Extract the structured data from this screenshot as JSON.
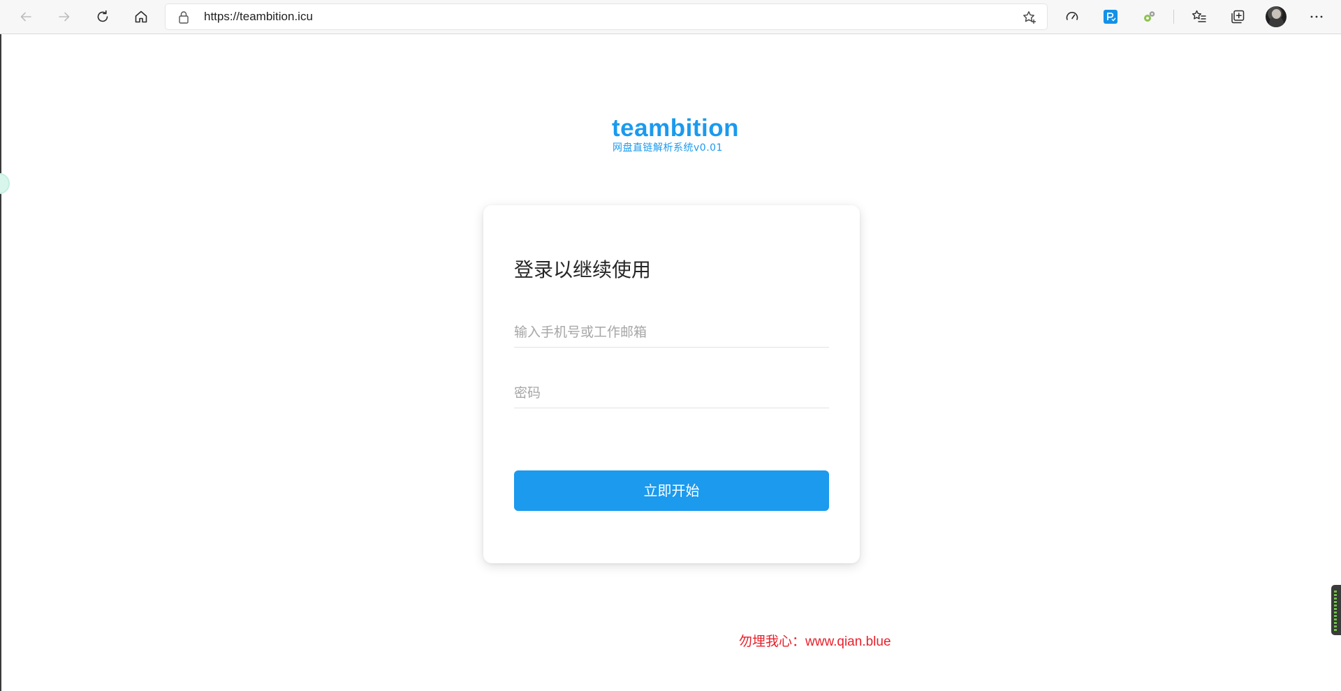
{
  "browser": {
    "url": "https://teambition.icu",
    "icons": {
      "back": "back-arrow-icon",
      "forward": "forward-arrow-icon",
      "refresh": "refresh-icon",
      "home": "home-icon",
      "lock": "lock-icon",
      "favorite": "star-add-icon",
      "performance": "speedometer-icon",
      "extension_1": "extension-p-icon",
      "extension_2": "extension-gear-icon",
      "favorites": "favorites-list-icon",
      "collections": "collections-icon",
      "profile": "profile-avatar",
      "menu": "more-menu-icon"
    }
  },
  "brand": {
    "name": "teambition",
    "subtitle": "网盘直链解析系统v0.01",
    "color": "#1b9aee"
  },
  "login": {
    "heading": "登录以继续使用",
    "account_placeholder": "输入手机号或工作邮箱",
    "password_placeholder": "密码",
    "submit_label": "立即开始"
  },
  "footer": {
    "note": "勿埋我心：www.qian.blue",
    "color": "#e8202b"
  }
}
